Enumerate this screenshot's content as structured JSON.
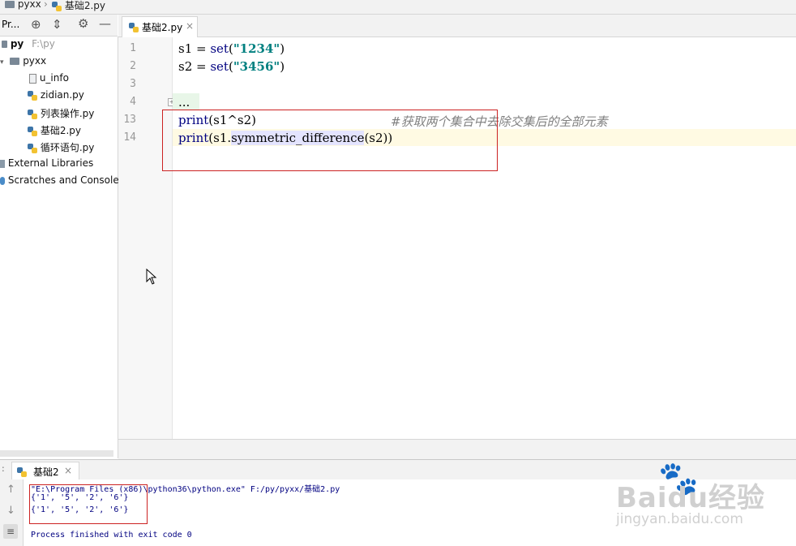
{
  "breadcrumb": {
    "project": "pyxx",
    "file": "基础2.py"
  },
  "project_panel": {
    "title": "Pr...",
    "tree": [
      {
        "label": "py",
        "meta": "F:\\py"
      },
      {
        "label": "pyxx"
      },
      {
        "label": "u_info"
      },
      {
        "label": "zidian.py"
      },
      {
        "label": "列表操作.py"
      },
      {
        "label": "基础2.py"
      },
      {
        "label": "循环语句.py"
      },
      {
        "label": "External Libraries"
      },
      {
        "label": "Scratches and Consoles"
      }
    ]
  },
  "editor": {
    "tab_label": "基础2.py",
    "lines": [
      {
        "num": "1",
        "parts": [
          "s1 = ",
          "set",
          "(",
          "\"1234\"",
          ")"
        ]
      },
      {
        "num": "2",
        "parts": [
          "s2 = ",
          "set",
          "(",
          "\"3456\"",
          ")"
        ]
      },
      {
        "num": "3",
        "parts": []
      },
      {
        "num": "4",
        "parts": [
          "..."
        ]
      },
      {
        "num": "13",
        "parts": [
          "print",
          "(s1^s2)",
          "#获取两个集合中去除交集后的全部元素"
        ]
      },
      {
        "num": "14",
        "parts": [
          "print",
          "(s1.",
          "symmetric_difference",
          "(s2))"
        ]
      }
    ]
  },
  "run": {
    "tab_label": "基础2",
    "command": "\"E:\\Program Files (x86)\\python36\\python.exe\" F:/py/pyxx/基础2.py",
    "output": [
      "{'1', '5', '2', '6'}",
      "{'1', '5', '2', '6'}"
    ],
    "exit": "Process finished with exit code 0"
  },
  "watermark": {
    "brand": "Baidu经验",
    "url": "jingyan.baidu.com"
  },
  "colors": {
    "highlight_box": "#cc2222",
    "keyword": "#000080",
    "string": "#008080"
  }
}
